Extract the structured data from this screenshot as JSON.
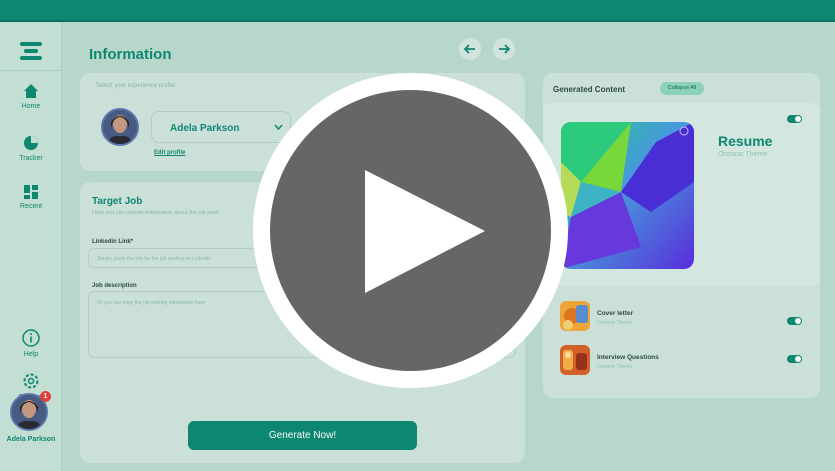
{
  "page": {
    "title": "Information"
  },
  "sidebar": {
    "items": [
      {
        "label": "Home",
        "icon": "home-icon"
      },
      {
        "label": "Tracker",
        "icon": "pie-chart-icon"
      },
      {
        "label": "Recent",
        "icon": "grid-icon"
      },
      {
        "label": "Help",
        "icon": "info-icon"
      },
      {
        "label": "Settings",
        "icon": "gear-icon"
      }
    ],
    "user": {
      "name": "Adela Parkson",
      "notifications": "1"
    }
  },
  "profile": {
    "label": "Select your experience profile",
    "selected": "Adela Parkson",
    "edit_label": "Edit profile"
  },
  "target_job": {
    "title": "Target Job",
    "subtitle": "Here you can include information about the job posti",
    "linkedin_label": "Linkedin Link*",
    "linkedin_placeholder": "Simply paste the link for the job posting on Linkedin",
    "description_label": "Job description",
    "description_placeholder": "Or you can copy the job posting information here"
  },
  "generate_button": "Generate Now!",
  "generated": {
    "title": "Generated Content",
    "collapse_label": "Collapse All",
    "items": [
      {
        "title": "Resume",
        "theme": "Oceanic Theme",
        "enabled": true
      },
      {
        "title": "Cover letter",
        "theme": "Oceanic Theme",
        "enabled": true
      },
      {
        "title": "Interview Questions",
        "theme": "Oceanic Theme",
        "enabled": true
      }
    ]
  },
  "colors": {
    "accent": "#0f8a74",
    "background": "#bcdcd0",
    "overlay_play": "#666666"
  }
}
